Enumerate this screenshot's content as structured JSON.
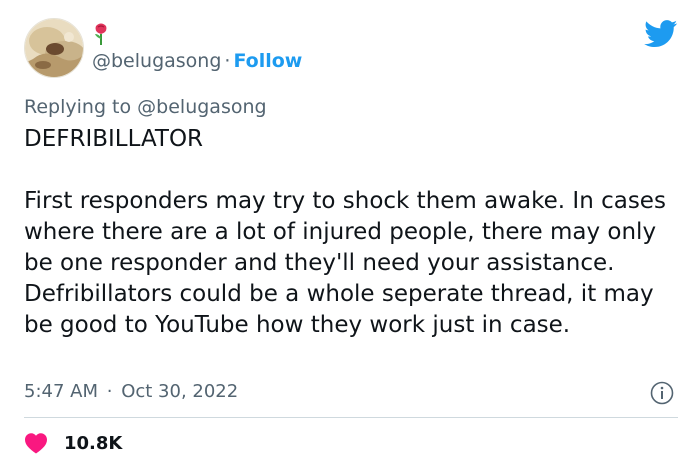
{
  "tweet": {
    "handle": "@belugasong",
    "separator": "·",
    "follow_label": "Follow",
    "reply_prefix": "Replying to",
    "reply_handle": "@belugasong",
    "heading": "DEFRIBILLATOR",
    "paragraph": "First responders may try to shock them awake. In cases where there are a lot of injured people, there may only be one responder and they'll need your assistance. Defribillators could be a whole seperate thread, it may be good to YouTube how they work just in case.",
    "time": "5:47 AM",
    "date": "Oct 30, 2022",
    "like_count": "10.8K"
  },
  "icons": {
    "brand": "twitter-bird-icon",
    "info": "info-icon",
    "like": "heart-icon",
    "emoji": "rose-icon"
  },
  "colors": {
    "twitter_blue": "#1d9bf0",
    "secondary_text": "#536471",
    "primary_text": "#0f1419",
    "like_pink": "#f91880",
    "divider": "#cfd9de"
  }
}
